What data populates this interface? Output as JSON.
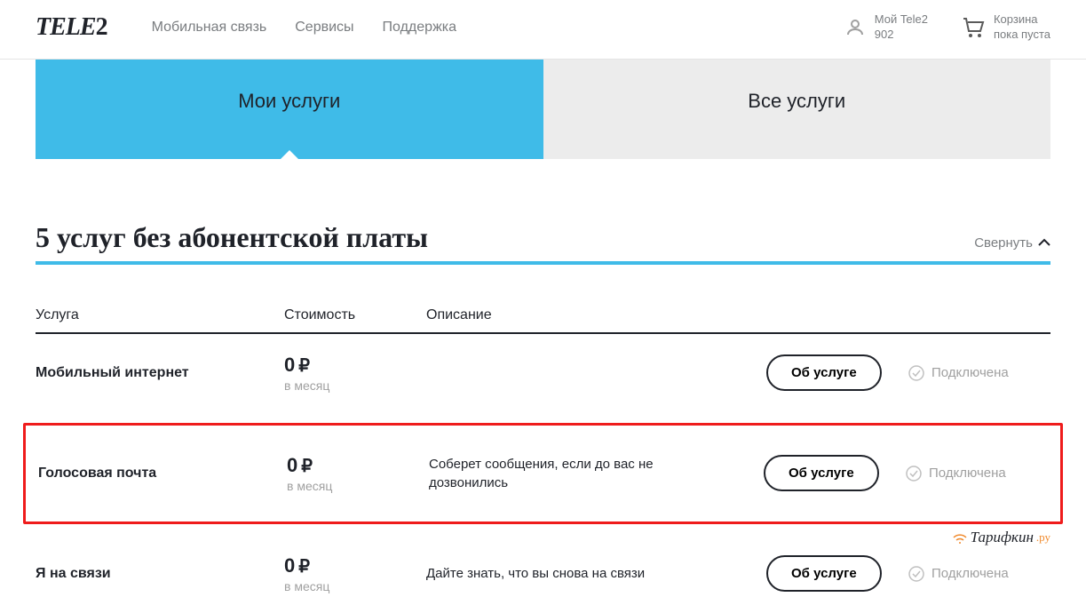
{
  "header": {
    "logo": "TELE2",
    "nav": [
      "Мобильная связь",
      "Сервисы",
      "Поддержка"
    ],
    "account": {
      "line1": "Мой Tele2",
      "line2": "902"
    },
    "cart": {
      "line1": "Корзина",
      "line2": "пока пуста"
    }
  },
  "tabs": [
    {
      "label": "Мои услуги",
      "active": true
    },
    {
      "label": "Все услуги",
      "active": false
    }
  ],
  "section": {
    "title": "5 услуг без абонентской платы",
    "collapse_label": "Свернуть"
  },
  "table": {
    "headers": {
      "name": "Услуга",
      "cost": "Стоимость",
      "desc": "Описание"
    }
  },
  "rows": [
    {
      "name": "Мобильный интернет",
      "price": "0",
      "currency": "₽",
      "period": "в месяц",
      "desc": "",
      "button": "Об услуге",
      "status": "Подключена",
      "highlight": false
    },
    {
      "name": "Голосовая почта",
      "price": "0",
      "currency": "₽",
      "period": "в месяц",
      "desc": "Соберет сообщения, если до вас не дозвонились",
      "button": "Об услуге",
      "status": "Подключена",
      "highlight": true
    },
    {
      "name": "Я на связи",
      "price": "0",
      "currency": "₽",
      "period": "в месяц",
      "desc": "Дайте знать, что вы снова на связи",
      "button": "Об услуге",
      "status": "Подключена",
      "highlight": false
    }
  ],
  "watermark": {
    "text": "Тарифкин",
    "suffix": ".ру"
  }
}
